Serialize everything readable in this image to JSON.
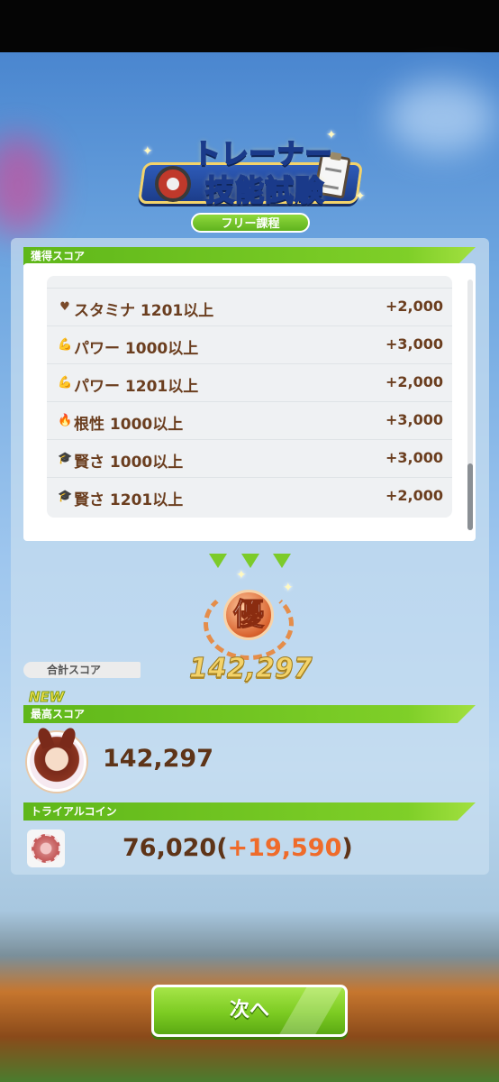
{
  "header": {
    "title_line1": "トレーナー",
    "title_line2": "技能試験",
    "subtitle": "フリー課程"
  },
  "score_section": {
    "label": "獲得スコア",
    "rows": [
      {
        "icon": "heart-icon",
        "glyph": "♥",
        "label": "スタミナ 1201以上",
        "points": "+2,000"
      },
      {
        "icon": "muscle-icon",
        "glyph": "💪",
        "label": "パワー 1000以上",
        "points": "+3,000"
      },
      {
        "icon": "muscle-icon",
        "glyph": "💪",
        "label": "パワー 1201以上",
        "points": "+2,000"
      },
      {
        "icon": "flame-icon",
        "glyph": "🔥",
        "label": "根性 1000以上",
        "points": "+3,000"
      },
      {
        "icon": "graduation-cap-icon",
        "glyph": "🎓",
        "label": "賢さ 1000以上",
        "points": "+3,000"
      },
      {
        "icon": "graduation-cap-icon",
        "glyph": "🎓",
        "label": "賢さ 1201以上",
        "points": "+2,000"
      }
    ]
  },
  "rank": {
    "grade": "優",
    "total_label": "合計スコア",
    "total_score": "142,297"
  },
  "best_score": {
    "badge": "NEW",
    "label": "最高スコア",
    "value": "142,297"
  },
  "trial_coin": {
    "label": "トライアルコイン",
    "total": "76,020",
    "gain": "+19,590"
  },
  "next_button": {
    "label": "次へ"
  },
  "colors": {
    "accent_green": "#7ccb22",
    "text_brown": "#6b3e1f",
    "gain_orange": "#ef6b2a",
    "gold": "#f4d36a"
  }
}
